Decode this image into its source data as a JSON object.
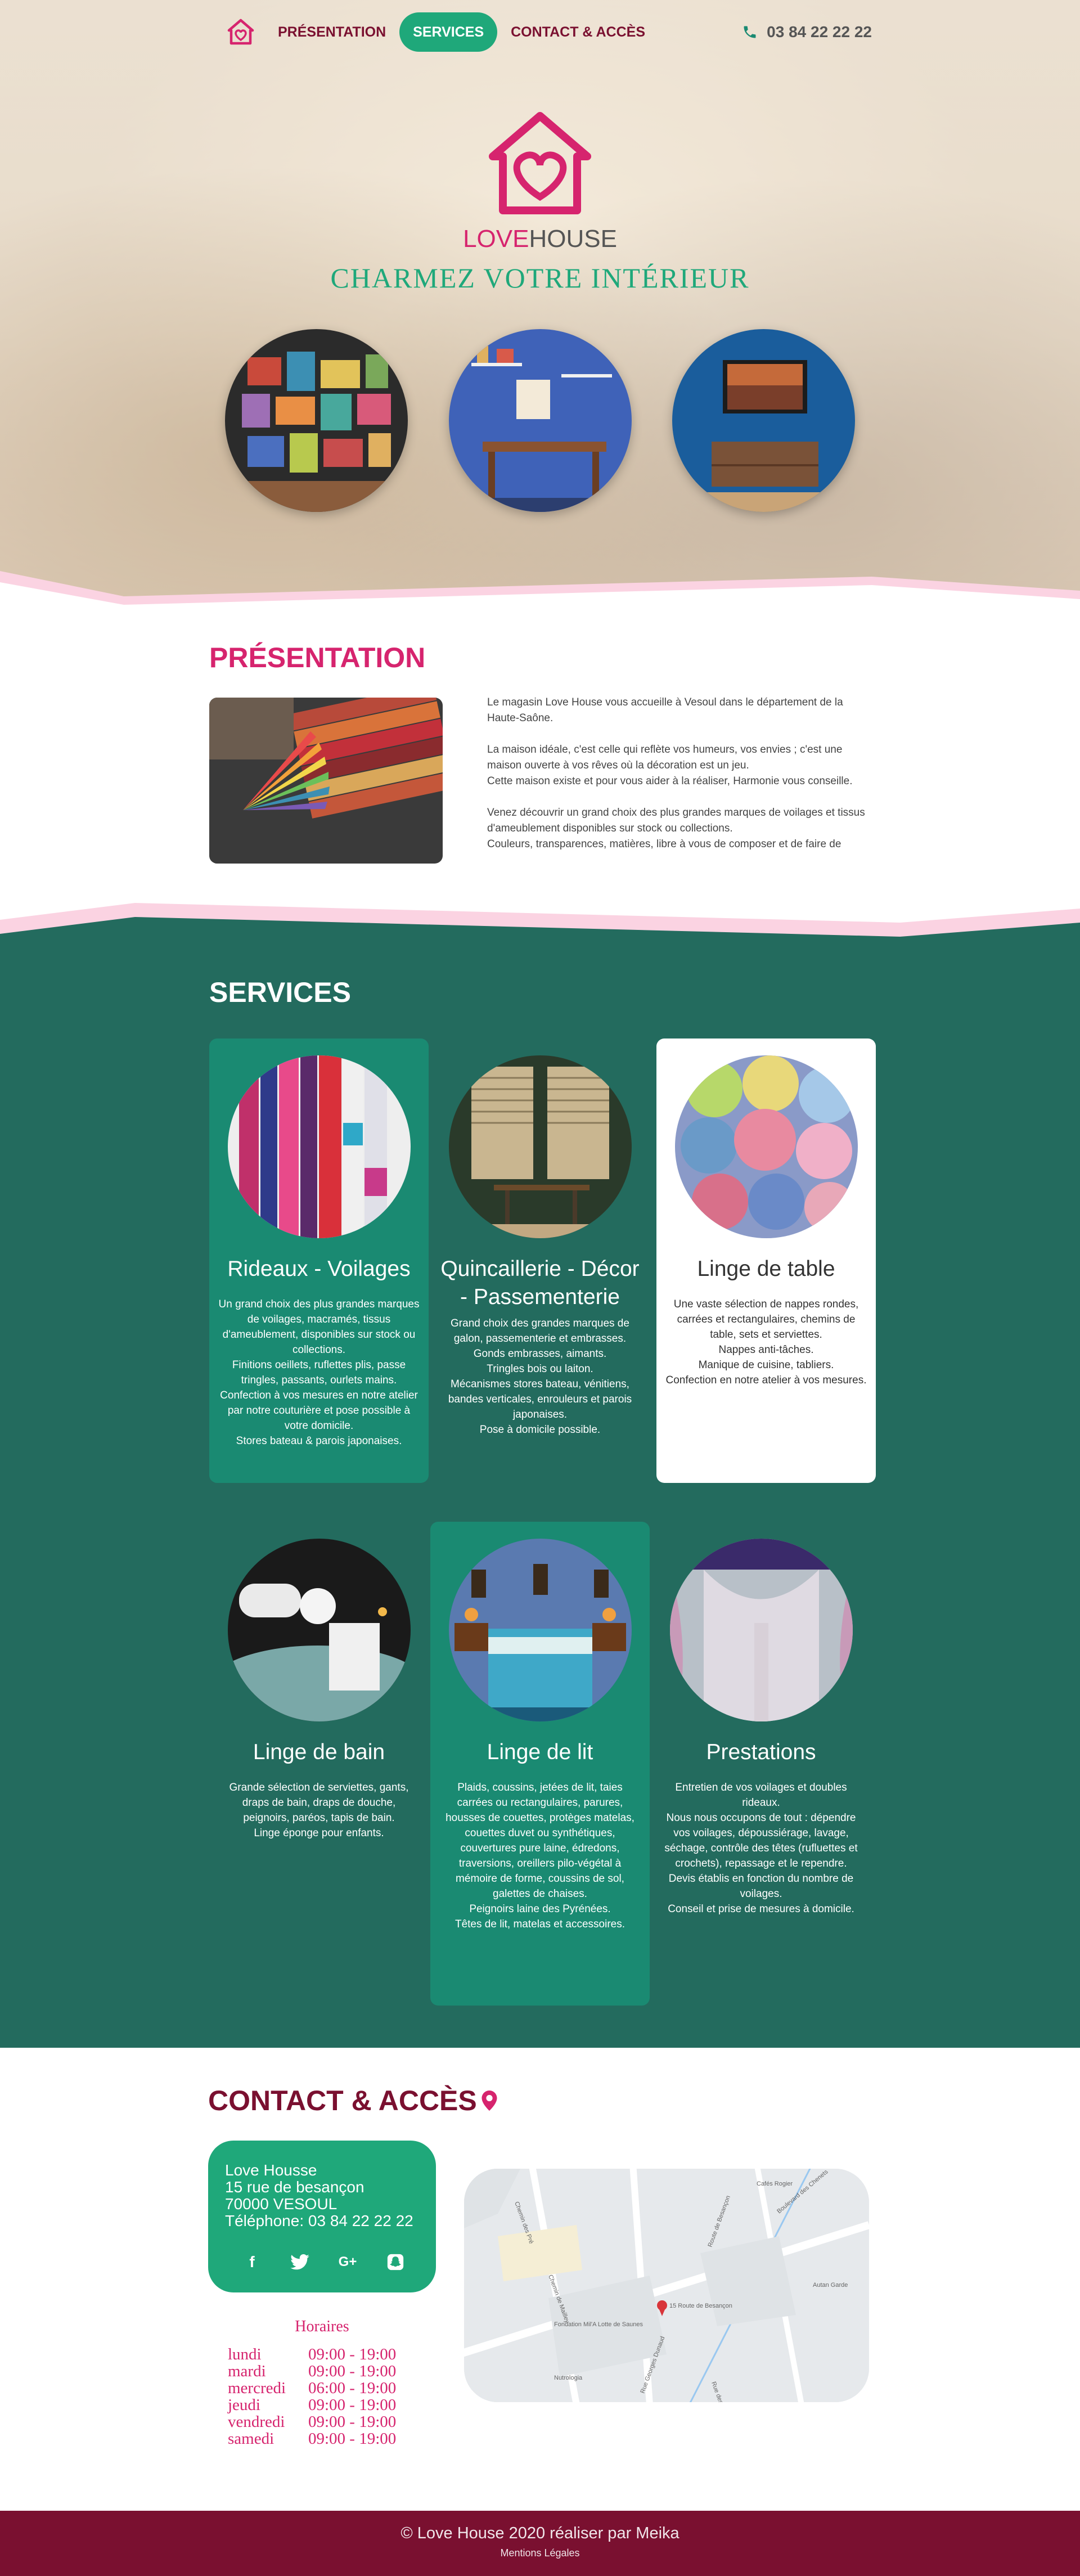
{
  "nav": {
    "items": [
      "PRÉSENTATION",
      "SERVICES",
      "CONTACT & ACCÈS"
    ],
    "phone": "03 84 22 22 22"
  },
  "hero": {
    "brand_love": "LOVE",
    "brand_house": "HOUSE",
    "tagline": "CHARMEZ VOTRE INTÉRIEUR"
  },
  "presentation": {
    "title": "PRÉSENTATION",
    "p1": "Le magasin Love House vous accueille à Vesoul dans le département de la Haute-Saône.",
    "p2a": "La maison idéale, c'est celle qui reflète vos humeurs, vos envies ; c'est une maison ouverte à vos rêves où la décoration est un jeu.",
    "p2b": "Cette maison existe et pour vous aider à la réaliser, Harmonie vous conseille.",
    "p3a": "Venez découvrir un grand choix des plus grandes marques de voilages et tissus d'ameublement disponibles sur stock ou collections.",
    "p3b": "Couleurs, transparences, matières, libre à vous de composer et de faire de"
  },
  "services": {
    "title": "SERVICES",
    "cards": [
      {
        "title": "Rideaux - Voilages",
        "text": "Un grand choix des plus grandes marques de voilages, macramés, tissus d'ameublement, disponibles sur stock ou collections.\nFinitions oeillets, ruflettes plis, passe tringles, passants, ourlets mains. Confection à vos mesures en notre atelier par notre couturière et pose possible à votre domicile.\nStores bateau & parois japonaises."
      },
      {
        "title": "Quincaillerie - Décor - Passementerie",
        "text": "Grand choix des grandes marques de galon, passementerie et embrasses.\nGonds embrasses, aimants.\nTringles bois ou laiton.\nMécanismes stores bateau, vénitiens, bandes verticales, enrouleurs et parois japonaises.\nPose à domicile possible."
      },
      {
        "title": "Linge de table",
        "text": "Une vaste sélection de nappes rondes, carrées et rectangulaires, chemins de table, sets et serviettes.\nNappes anti-tâches.\nManique de cuisine, tabliers.\nConfection en notre atelier à vos mesures."
      },
      {
        "title": "Linge de bain",
        "text": "Grande sélection de serviettes, gants, draps de bain, draps de douche, peignoirs, paréos, tapis de bain.\nLinge éponge pour enfants."
      },
      {
        "title": "Linge de lit",
        "text": "Plaids, coussins, jetées de lit, taies carrées ou rectangulaires, parures, housses de couettes, protèges matelas, couettes duvet ou synthétiques, couvertures pure laine, édredons, traversions, oreillers pilo-végétal à mémoire de forme, coussins de sol, galettes de chaises.\nPeignoirs laine des Pyrénées.\nTêtes de lit, matelas et accessoires."
      },
      {
        "title": "Prestations",
        "text": "Entretien de vos voilages et doubles rideaux.\nNous nous occupons de tout : dépendre vos voilages, dépoussiérage, lavage, séchage, contrôle des têtes (rufluettes et crochets), repassage et le rependre.\nDevis établis en fonction du nombre de voilages.\nConseil et prise de mesures à domicile."
      }
    ]
  },
  "contact": {
    "title": "CONTACT & ACCÈS",
    "name": "Love Housse",
    "street": "15 rue de besançon",
    "city": "70000 VESOUL",
    "phone": "Téléphone: 03 84 22 22 22",
    "hours_title": "Horaires",
    "hours": [
      {
        "day": "lundi",
        "time": "09:00 - 19:00"
      },
      {
        "day": "mardi",
        "time": "09:00 - 19:00"
      },
      {
        "day": "mercredi",
        "time": "06:00 - 19:00"
      },
      {
        "day": "jeudi",
        "time": "09:00 - 19:00"
      },
      {
        "day": "vendredi",
        "time": "09:00 - 19:00"
      },
      {
        "day": "samedi",
        "time": "09:00 - 19:00"
      }
    ],
    "map": {
      "labels": [
        "Cafés Rogier",
        "Autan Garde",
        "15 Route de Besançon",
        "Fondation Mil'A Lotte de Saunes",
        "Nutrologia",
        "Rue Georges Dunaud",
        "Boulevard des Chenets",
        "Rue des Alouettes",
        "Route de Besançon",
        "Chemin de Mailley",
        "Chemin des Pré"
      ]
    }
  },
  "footer": {
    "copy": "© Love House 2020 réaliser par Meika",
    "legal": "Mentions Légales"
  },
  "colors": {
    "pink": "#d6246e",
    "green": "#1fa87a",
    "services_bg": "#236b5e",
    "card_teal": "#1a8a72",
    "burgundy": "#7a1030"
  },
  "icons": [
    "house-heart-icon",
    "phone-icon",
    "map-pin-icon",
    "facebook-icon",
    "twitter-icon",
    "google-plus-icon",
    "snapchat-icon"
  ]
}
